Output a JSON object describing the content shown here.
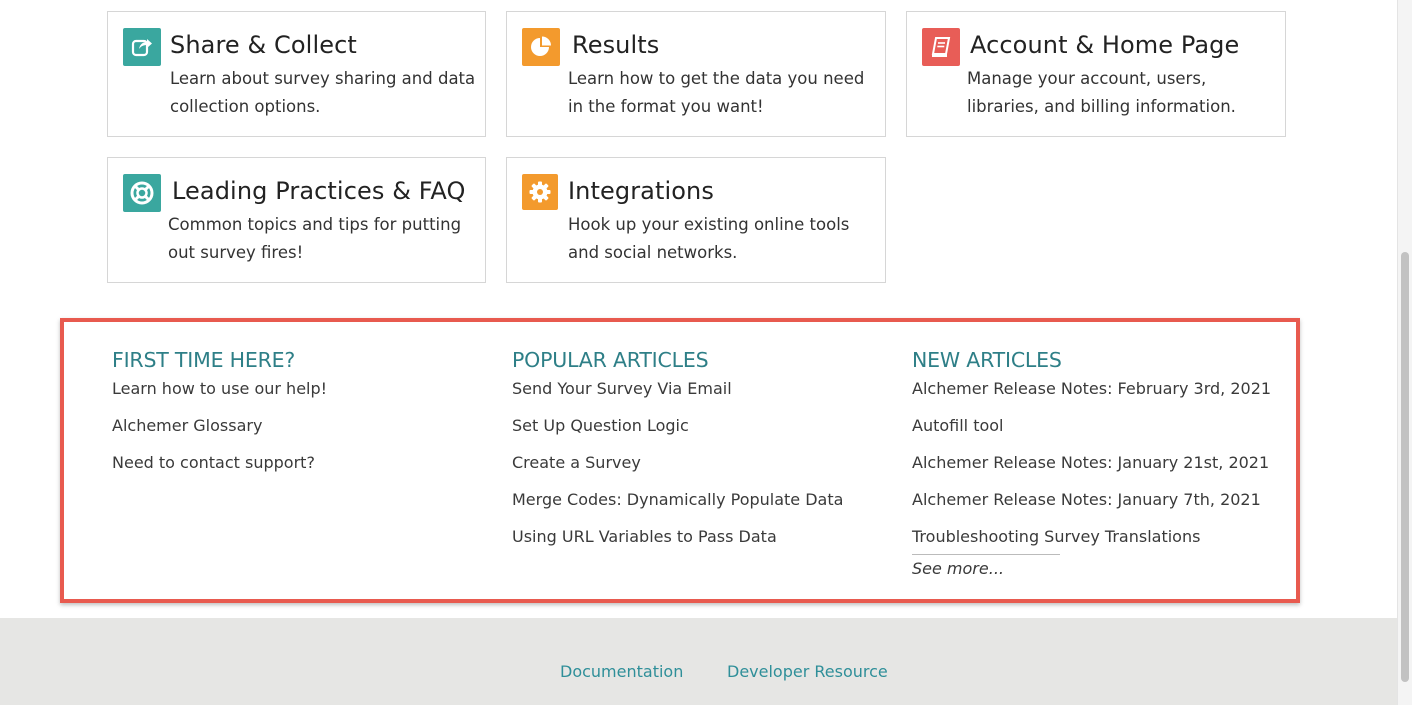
{
  "cards": [
    {
      "title": "Share & Collect",
      "desc": "Learn about survey sharing and data\ncollection options.",
      "icon": "share-icon",
      "icon_color": "#3aa79f"
    },
    {
      "title": "Results",
      "desc": "Learn how to get the data you need\nin the format you want!",
      "icon": "pie-chart-icon",
      "icon_color": "#f39a2d"
    },
    {
      "title": "Account & Home Page",
      "desc": "Manage your account, users,\nlibraries, and billing information.",
      "icon": "book-icon",
      "icon_color": "#e85d57"
    },
    {
      "title": "Leading Practices & FAQ",
      "desc": "Common topics and tips for putting\nout survey fires!",
      "icon": "life-ring-icon",
      "icon_color": "#3aa79f"
    },
    {
      "title": "Integrations",
      "desc": "Hook up your existing online tools\nand social networks.",
      "icon": "gear-icon",
      "icon_color": "#f39a2d"
    }
  ],
  "first_time": {
    "heading": "FIRST TIME HERE?",
    "links": [
      "Learn how to use our help!",
      "Alchemer Glossary",
      "Need to contact support?"
    ]
  },
  "popular": {
    "heading": "POPULAR ARTICLES",
    "links": [
      "Send Your Survey Via Email",
      "Set Up Question Logic",
      "Create a Survey",
      "Merge Codes: Dynamically Populate Data",
      "Using URL Variables to Pass Data"
    ]
  },
  "new_articles": {
    "heading": "NEW ARTICLES",
    "links": [
      "Alchemer Release Notes: February 3rd, 2021",
      "Autofill tool",
      "Alchemer Release Notes: January 21st, 2021",
      "Alchemer Release Notes: January 7th, 2021",
      "Troubleshooting Survey Translations"
    ],
    "see_more": "See more..."
  },
  "footer": {
    "documentation": "Documentation",
    "developer": "Developer Resource"
  },
  "colors": {
    "heading": "#2e7f87",
    "highlight_border": "#e85a4f",
    "footer_link": "#2f8f99"
  }
}
